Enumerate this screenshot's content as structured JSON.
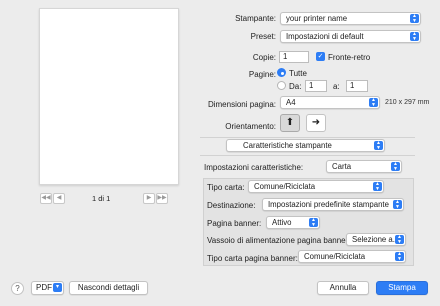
{
  "preview": {
    "page_label": "1 di 1"
  },
  "printer": {
    "label": "Stampante:",
    "value": "your printer name"
  },
  "preset": {
    "label": "Preset:",
    "value": "Impostazioni di default"
  },
  "copies": {
    "label": "Copie:",
    "value": "1",
    "duplex_label": "Fronte-retro",
    "duplex_checked": true
  },
  "pages": {
    "label": "Pagine:",
    "all_label": "Tutte",
    "from_label": "Da:",
    "from_value": "1",
    "to_label": "a:",
    "to_value": "1"
  },
  "paper_size": {
    "label": "Dimensioni pagina:",
    "value": "A4",
    "dims": "210 x 297 mm"
  },
  "orientation": {
    "label": "Orientamento:"
  },
  "section": {
    "value": "Caratteristiche stampante"
  },
  "feature_set": {
    "label": "Impostazioni caratteristiche:",
    "value": "Carta"
  },
  "paper_type": {
    "label": "Tipo carta:",
    "value": "Comune/Riciclata"
  },
  "destination": {
    "label": "Destinazione:",
    "value": "Impostazioni predefinite stampante"
  },
  "banner": {
    "label": "Pagina banner:",
    "value": "Attivo"
  },
  "banner_tray": {
    "label": "Vassoio di alimentazione pagina banner:",
    "value": "Selezione a..."
  },
  "banner_paper": {
    "label": "Tipo carta pagina banner:",
    "value": "Comune/Riciclata"
  },
  "footer": {
    "help": "?",
    "pdf": "PDF",
    "details": "Nascondi dettagli",
    "cancel": "Annulla",
    "print": "Stampa"
  },
  "colors": {
    "accent": "#2d7df5",
    "background": "#ececec"
  }
}
